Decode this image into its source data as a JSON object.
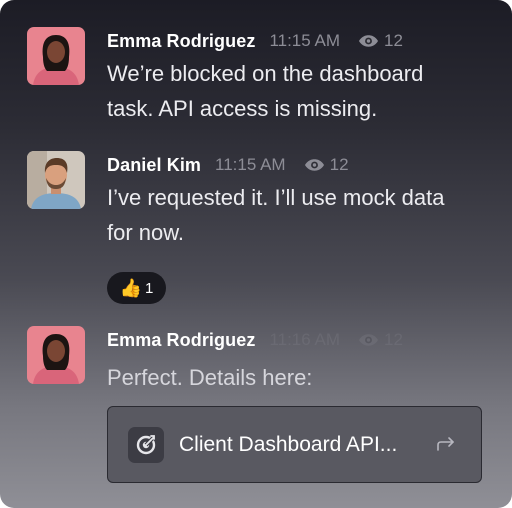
{
  "colors": {
    "username": "#ffffff",
    "meta": "#8d8d96",
    "message_text": "#ececf0",
    "reaction_bg": "#18181e",
    "attachment_bg": "#595961"
  },
  "messages": [
    {
      "author": "Emma Rodriguez",
      "time": "11:15 AM",
      "views": "12",
      "lines": [
        "We’re blocked on the dashboard",
        "task. API access is missing."
      ]
    },
    {
      "author": "Daniel Kim",
      "time": "11:15 AM",
      "views": "12",
      "lines": [
        "I’ve requested it. I’ll use mock data",
        "for now."
      ],
      "reaction": {
        "emoji": "👍",
        "icon": "thumbs-up-icon",
        "count": "1"
      }
    },
    {
      "author": "Emma Rodriguez",
      "time": "11:16 AM",
      "views": "12",
      "lines": [
        "Perfect. Details here:"
      ],
      "attachment": {
        "title": "Client Dashboard API...",
        "icon": "target-icon",
        "action_icon": "forward-arrow-icon"
      }
    }
  ]
}
